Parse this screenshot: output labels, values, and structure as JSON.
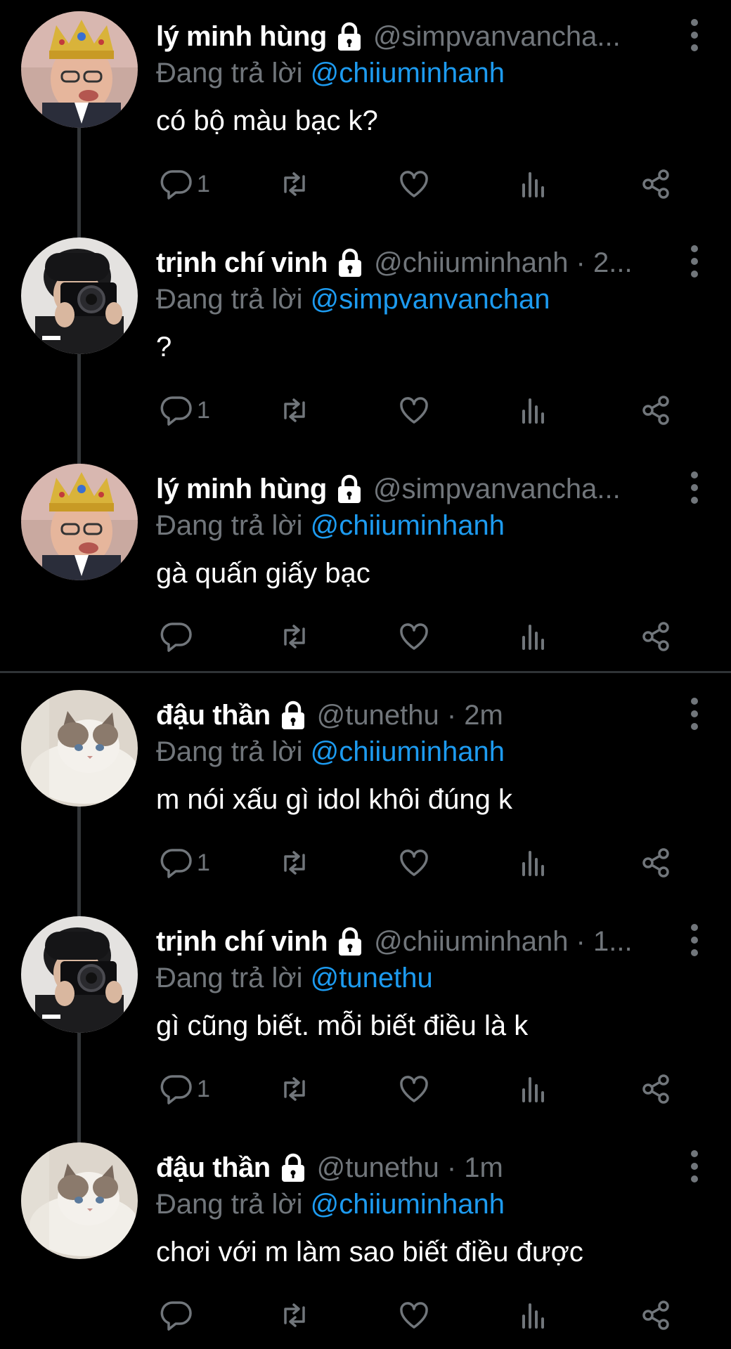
{
  "replying_label": "Đang trả lời",
  "tweets": [
    {
      "avatar": "crowned-man-avatar",
      "name": "lý minh hùng",
      "handle_meta": "@simpvanvancha...",
      "replying_to": "@chiiuminhanh",
      "text": "có bộ màu bạc k?",
      "reply_count": "1"
    },
    {
      "avatar": "camera-person-avatar",
      "name": "trịnh chí vinh",
      "handle_meta": "@chiiuminhanh · 2...",
      "replying_to": "@simpvanvanchan",
      "text": "?",
      "reply_count": "1"
    },
    {
      "avatar": "crowned-man-avatar",
      "name": "lý minh hùng",
      "handle_meta": "@simpvanvancha...",
      "replying_to": "@chiiuminhanh",
      "text": "gà quấn giấy bạc",
      "reply_count": ""
    },
    {
      "avatar": "cat-avatar",
      "name": "đậu thần",
      "handle_meta": "@tunethu · 2m",
      "replying_to": "@chiiuminhanh",
      "text": "m nói xấu gì idol khôi đúng k",
      "reply_count": "1"
    },
    {
      "avatar": "camera-person-avatar",
      "name": "trịnh chí vinh",
      "handle_meta": "@chiiuminhanh · 1...",
      "replying_to": "@tunethu",
      "text": "gì cũng biết. mỗi biết điều là k",
      "reply_count": "1"
    },
    {
      "avatar": "cat-avatar",
      "name": "đậu thần",
      "handle_meta": "@tunethu · 1m",
      "replying_to": "@chiiuminhanh",
      "text": "chơi với m làm sao biết điều được",
      "reply_count": ""
    }
  ],
  "colors": {
    "background": "#000000",
    "text": "#ffffff",
    "muted": "#71767b",
    "link": "#1d9bf0",
    "thread_line": "#333639"
  }
}
